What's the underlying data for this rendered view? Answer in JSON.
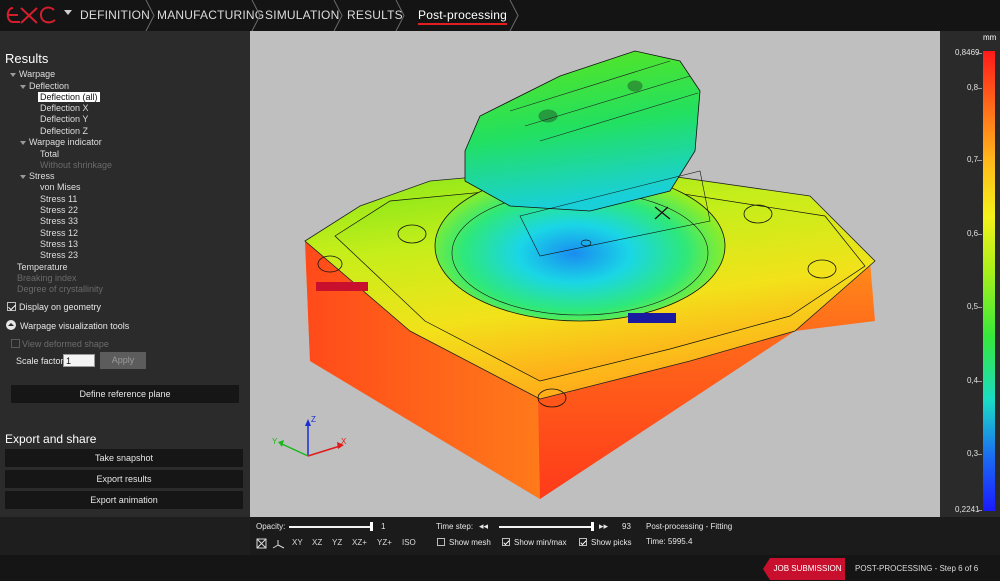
{
  "nav": {
    "logo": "e-Xstream logo",
    "crumbs": [
      "DEFINITION",
      "MANUFACTURING",
      "SIMULATION",
      "RESULTS",
      "Post-processing"
    ]
  },
  "results": {
    "title": "Results",
    "tree": {
      "warpage": "Warpage",
      "deflection": "Deflection",
      "deflection_all": "Deflection (all)",
      "deflection_x": "Deflection X",
      "deflection_y": "Deflection Y",
      "deflection_z": "Deflection Z",
      "warpage_indicator": "Warpage indicator",
      "total": "Total",
      "without_shrinkage": "Without shrinkage",
      "stress": "Stress",
      "von_mises": "von Mises",
      "stress_11": "Stress 11",
      "stress_22": "Stress 22",
      "stress_33": "Stress 33",
      "stress_12": "Stress 12",
      "stress_13": "Stress 13",
      "stress_23": "Stress 23",
      "temperature": "Temperature",
      "breaking_index": "Breaking index",
      "degree_crystallinity": "Degree of crystallinity"
    },
    "display_on_geometry": "Display on geometry",
    "warpage_tools": "Warpage visualization tools",
    "view_deformed": "View deformed shape",
    "scale_factor_label": "Scale factor:",
    "scale_factor_value": "1",
    "apply": "Apply",
    "define_plane": "Define reference plane"
  },
  "export": {
    "title": "Export and share",
    "snapshot": "Take snapshot",
    "results": "Export results",
    "animation": "Export animation"
  },
  "legend": {
    "unit": "mm",
    "max": "0,8469",
    "ticks": [
      "0,8",
      "0,7",
      "0,6",
      "0,5",
      "0,4",
      "0,3"
    ],
    "min": "0,2241"
  },
  "toolbar": {
    "opacity_label": "Opacity:",
    "opacity_value": "1",
    "opacity_fraction": 1.0,
    "timestep_label": "Time step:",
    "timestep_value": "93",
    "timestep_fraction": 1.0,
    "show_mesh": "Show mesh",
    "show_minmax": "Show min/max",
    "show_picks": "Show picks",
    "view_buttons": [
      "XY",
      "XZ",
      "YZ",
      "XZ+",
      "YZ+",
      "ISO"
    ],
    "status_title": "Post-processing - Fitting",
    "time": "Time: 5995.4"
  },
  "axes": {
    "x": "X",
    "y": "Y",
    "z": "Z"
  },
  "statusbar": {
    "job_submission": "JOB SUBMISSION",
    "step": "POST-PROCESSING - Step 6 of 6"
  },
  "colors": {
    "accent": "#c8102e",
    "viewport_bg": "#bfbfbf",
    "panel_bg": "#2b2b2b"
  }
}
